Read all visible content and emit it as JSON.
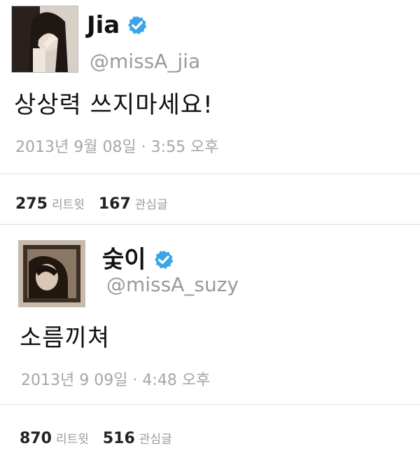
{
  "tweets": [
    {
      "display_name": "Jia",
      "handle": "@missA_jia",
      "text": "상상력 쓰지마세요!",
      "timestamp": "2013년 9월 08일 · 3:55 오후",
      "retweet_count": "275",
      "retweet_label": "리트윗",
      "favorite_count": "167",
      "favorite_label": "관심글",
      "avatar_icon": "profile-photo",
      "verified_icon": "verified-badge-icon"
    },
    {
      "display_name": "숯이",
      "handle": "@missA_suzy",
      "text": "소름끼쳐",
      "timestamp": "2013년 9 09일 · 4:48 오후",
      "retweet_count": "870",
      "retweet_label": "리트윗",
      "favorite_count": "516",
      "favorite_label": "관심글",
      "avatar_icon": "profile-photo",
      "verified_icon": "verified-badge-icon"
    }
  ],
  "colors": {
    "verified": "#3aa6e8",
    "handle": "#9a9a9a",
    "timestamp": "#a6a6a6",
    "divider": "#e2e2e2"
  }
}
